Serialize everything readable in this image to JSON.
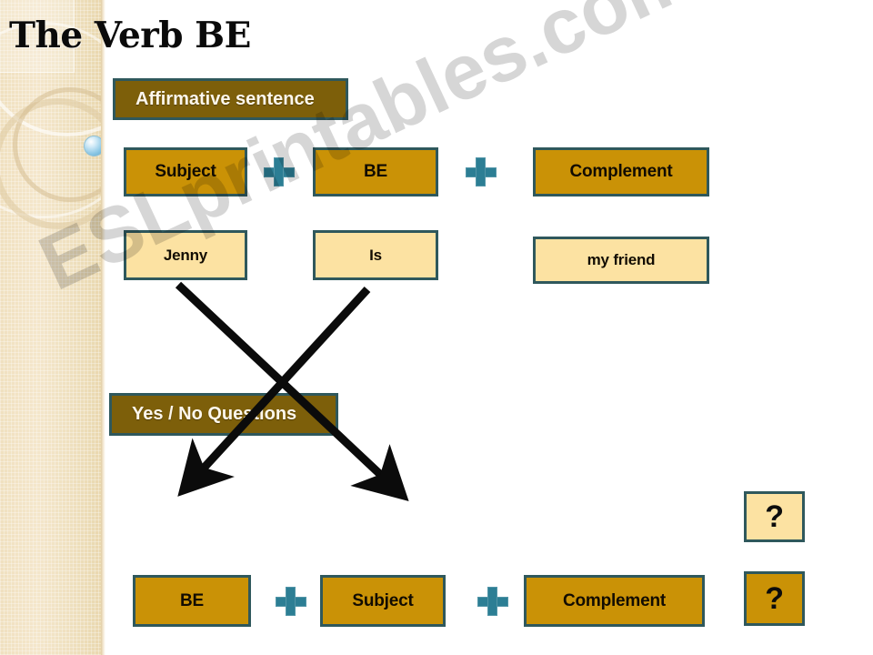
{
  "slide": {
    "title": "The Verb BE",
    "watermark": "ESLprintables.com"
  },
  "sections": {
    "affirmative": {
      "header": "Affirmative sentence",
      "structure_labels": [
        "Subject",
        "BE",
        "Complement"
      ],
      "example_values": [
        "Jenny",
        "Is",
        "my friend"
      ],
      "operators": [
        "+",
        "+"
      ]
    },
    "questions": {
      "header": "Yes / No Questions",
      "structure_labels": [
        "BE",
        "Subject",
        "Complement"
      ],
      "operators": [
        "+",
        "+"
      ],
      "question_marks": [
        "?",
        "?"
      ]
    }
  },
  "colors": {
    "gold": "#ca9206",
    "cream": "#fce2a2",
    "brown": "#7d5f0a",
    "teal_border": "#2f585c",
    "plus_teal": "#2c7e94",
    "sidebar_beige": "#f0e0bf",
    "arrow_black": "#0b0b0b",
    "title_black": "#0a0a0a"
  }
}
